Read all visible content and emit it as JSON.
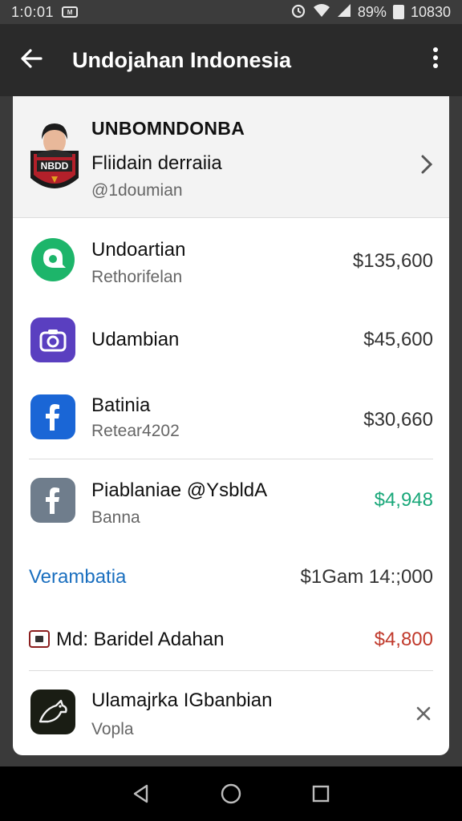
{
  "status": {
    "time": "1:0:01",
    "mini_label": "M",
    "battery": "89%",
    "clock": "10830"
  },
  "app_bar": {
    "title": "Undojahan Indonesia"
  },
  "profile": {
    "name": "UNBOMNDONBA",
    "subtitle": "Fliidain derraiia",
    "handle": "@1doumian",
    "badge_text": "NBDD"
  },
  "rows": [
    {
      "title": "Undoartian",
      "subtitle": "Rethorifelan",
      "amount": "$135,600",
      "icon": "chat-bubble-icon",
      "color": "#1db56a"
    },
    {
      "title": "Udambian",
      "subtitle": "",
      "amount": "$45,600",
      "icon": "camera-icon",
      "color": "#5a3fc0"
    },
    {
      "title": "Batinia",
      "subtitle": "Retear4202",
      "amount": "$30,660",
      "icon": "facebook-icon",
      "color": "#1a66d6"
    },
    {
      "title": "Piablaniae @YsbldA",
      "subtitle": "Banna",
      "amount": "$4,948",
      "icon": "facebook-gray-icon",
      "color": "#6f7d8c",
      "amount_color": "#1aa87a"
    }
  ],
  "section": {
    "label": "Verambatia",
    "amount": "$1Gam 14:;000",
    "label_color": "#1a6fbf"
  },
  "detail_row": {
    "title": "Md: Baridel Adahan",
    "amount": "$4,800",
    "amount_color": "#c0392b"
  },
  "last_row": {
    "title": "Ulamajrka IGbanbian",
    "subtitle": "Vopla",
    "icon": "bird-icon"
  }
}
